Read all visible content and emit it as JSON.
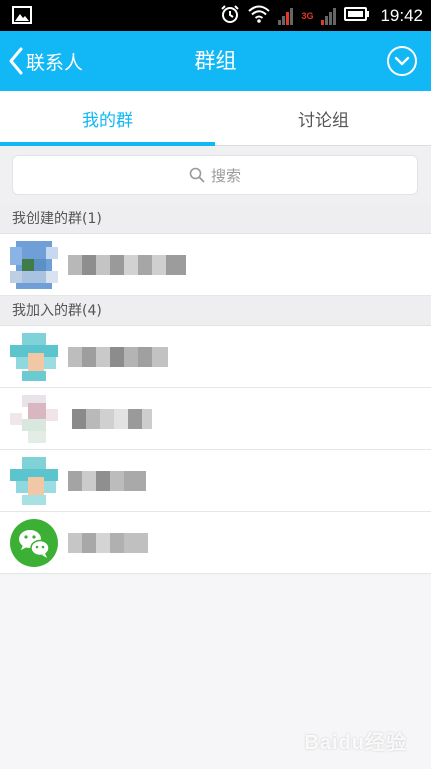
{
  "status_bar": {
    "time": "19:42",
    "network_label": "3G",
    "icons": [
      "image-icon",
      "alarm-icon",
      "wifi-icon",
      "signal-icon",
      "battery-icon"
    ]
  },
  "header": {
    "back_label": "联系人",
    "title": "群组",
    "menu_icon": "chevron-down-circle-icon",
    "background": "#12b7f5"
  },
  "tabs": [
    {
      "label": "我的群",
      "active": true
    },
    {
      "label": "讨论组",
      "active": false
    }
  ],
  "search": {
    "placeholder": "搜索"
  },
  "sections": {
    "created": {
      "title": "我创建的群(1)"
    },
    "joined": {
      "title": "我加入的群(4)"
    }
  },
  "groups": {
    "created": [
      {
        "avatar": "pixelated-avatar",
        "name_blurred": true
      }
    ],
    "joined": [
      {
        "avatar": "pixelated-avatar",
        "name_blurred": true
      },
      {
        "avatar": "pixelated-avatar",
        "name_blurred": true
      },
      {
        "avatar": "pixelated-avatar",
        "name_blurred": true
      },
      {
        "avatar": "wechat-logo-icon",
        "name_blurred": true
      }
    ]
  },
  "colors": {
    "accent": "#12b7f5",
    "wechat_green": "#3cb034"
  },
  "watermark": "Baidu经验"
}
